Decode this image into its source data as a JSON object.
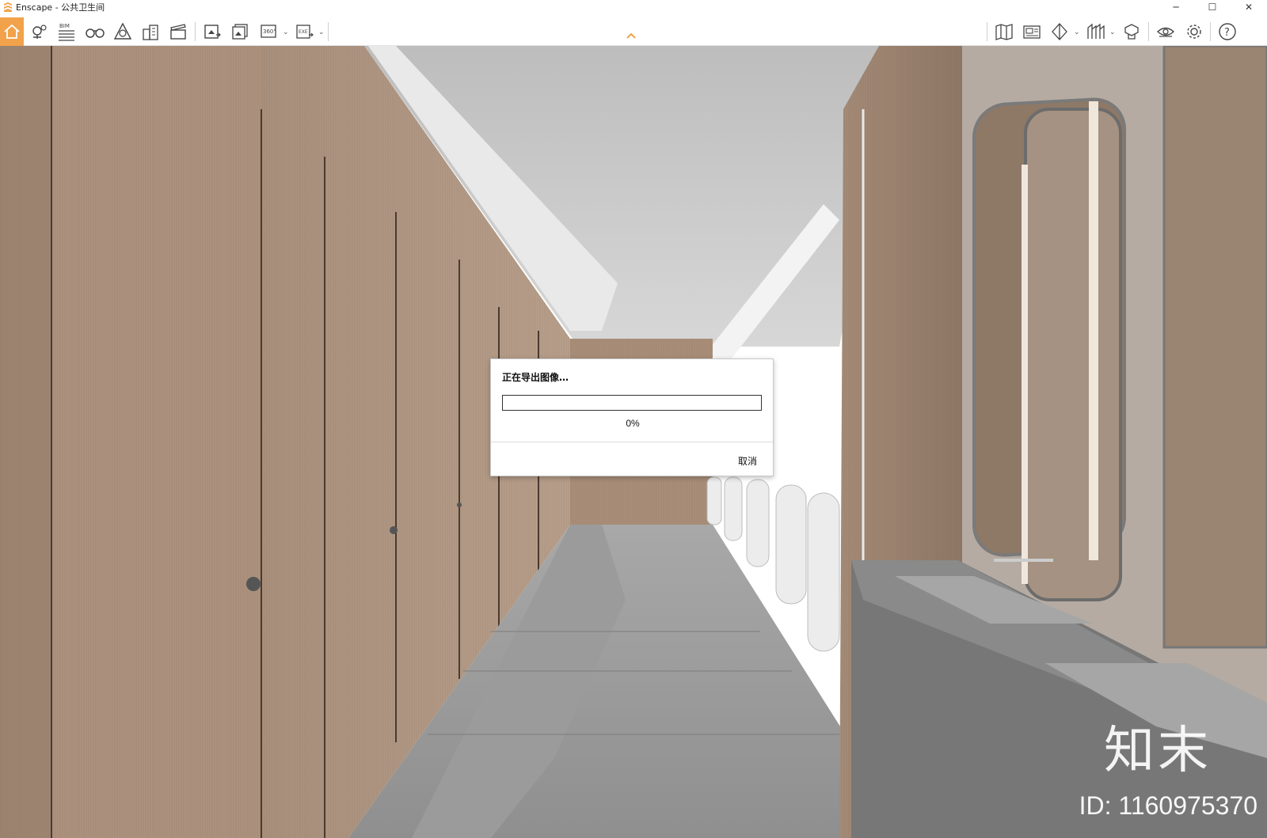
{
  "window": {
    "title": "Enscape - 公共卫生间",
    "minimize": "─",
    "maximize": "☐",
    "close": "✕"
  },
  "toolbar": {
    "accent": "#f2a24a",
    "left_tools": [
      "home-icon",
      "location-pin-icon",
      "bim-icon",
      "binoculars-icon",
      "asset-library-icon",
      "buildings-icon",
      "video-editor-icon",
      "screenshot-icon",
      "batch-render-icon",
      "panorama-360-icon",
      "export-exe-icon"
    ],
    "bim_label": "BIM",
    "pano_label": "360°",
    "exe_label": "EXE",
    "right_tools": [
      "map-icon",
      "views-icon",
      "cube-icon",
      "visual-settings-icon",
      "material-editor-icon",
      "eye-icon",
      "gear-icon",
      "help-icon"
    ],
    "help_label": "?"
  },
  "dialog": {
    "title": "正在导出图像…",
    "progress": 0,
    "percent_label": "0%",
    "cancel_label": "取消"
  },
  "watermark": {
    "logo_text": "知末",
    "id_text": "ID: 1160975370"
  }
}
